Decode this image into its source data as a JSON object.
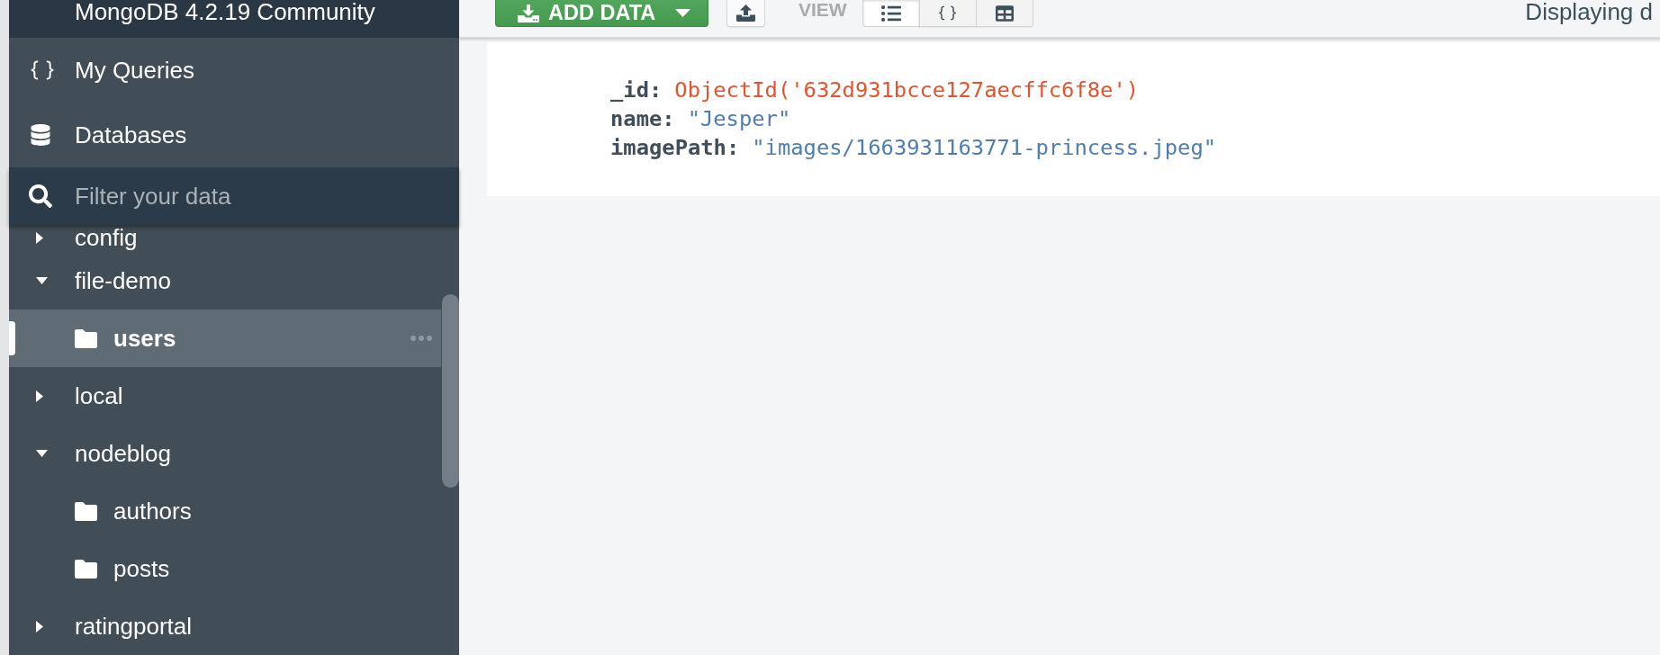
{
  "sidebar": {
    "title": "MongoDB 4.2.19 Community",
    "nav": [
      {
        "kind": "queries",
        "label": "My Queries"
      },
      {
        "kind": "databases",
        "label": "Databases"
      }
    ],
    "filter": {
      "placeholder": "Filter your data"
    },
    "databases": [
      {
        "name": "config",
        "expanded": false,
        "selected": false
      },
      {
        "name": "file-demo",
        "expanded": true,
        "selected": false,
        "children": [
          {
            "name": "users",
            "selected": true
          }
        ]
      },
      {
        "name": "local",
        "expanded": false,
        "selected": false
      },
      {
        "name": "nodeblog",
        "expanded": true,
        "selected": false,
        "children": [
          {
            "name": "authors",
            "selected": false
          },
          {
            "name": "posts",
            "selected": false
          }
        ]
      },
      {
        "name": "ratingportal",
        "expanded": false,
        "selected": false
      }
    ]
  },
  "toolbar": {
    "add_data": "ADD DATA",
    "view_label": "VIEW",
    "views": [
      {
        "kind": "list",
        "selected": true
      },
      {
        "kind": "json",
        "selected": false
      },
      {
        "kind": "table",
        "selected": false
      }
    ],
    "status": "Displaying d"
  },
  "document": {
    "fields": [
      {
        "key": "_id:",
        "kind": "objectid",
        "value": "ObjectId('632d931bcce127aecffc6f8e')"
      },
      {
        "key": "name:",
        "kind": "string",
        "value": "\"Jesper\""
      },
      {
        "key": "imagePath:",
        "kind": "string",
        "value": "\"images/1663931163771-princess.jpeg\""
      }
    ]
  }
}
